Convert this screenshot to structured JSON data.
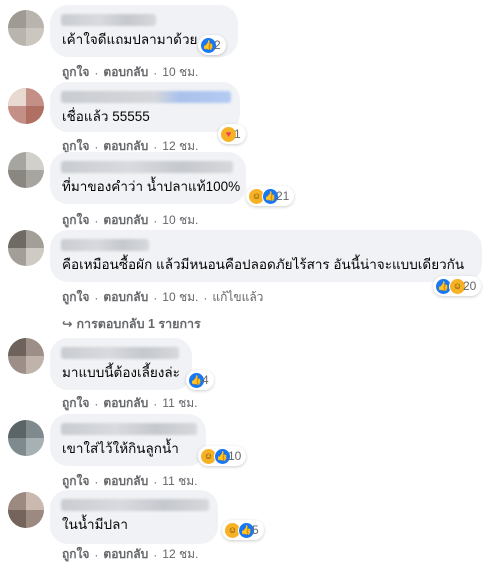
{
  "comments": [
    {
      "text": "เค้าใจดีแถมปลามาด้วย",
      "reactions": {
        "icons": [
          "like-icon"
        ],
        "count": "2"
      },
      "actions": {
        "like": "ถูกใจ",
        "reply": "ตอบกลับ",
        "time": "10 ชม."
      }
    },
    {
      "text": "เชื่อแล้ว 55555",
      "reactions": {
        "icons": [
          "care-icon"
        ],
        "count": "1"
      },
      "actions": {
        "like": "ถูกใจ",
        "reply": "ตอบกลับ",
        "time": "12 ชม."
      }
    },
    {
      "text": "ที่มาของคำว่า น้ำปลาแท้100%",
      "reactions": {
        "icons": [
          "haha-icon",
          "like-icon"
        ],
        "count": "21"
      },
      "actions": {
        "like": "ถูกใจ",
        "reply": "ตอบกลับ",
        "time": "10 ชม."
      }
    },
    {
      "text": "คือเหมือนซื้อผัก แล้วมีหนอนคือปลอดภัยไร้สาร อันนี้น่าจะแบบเดียวกัน",
      "reactions": {
        "icons": [
          "like-icon",
          "haha-icon"
        ],
        "count": "20"
      },
      "actions": {
        "like": "ถูกใจ",
        "reply": "ตอบกลับ",
        "time": "10 ชม.",
        "edited": "แก้ไขแล้ว"
      },
      "replies_label": "การตอบกลับ 1 รายการ"
    },
    {
      "text": "มาแบบนี้ต้องเลี้ยงล่ะ",
      "reactions": {
        "icons": [
          "like-icon"
        ],
        "count": "4"
      },
      "actions": {
        "like": "ถูกใจ",
        "reply": "ตอบกลับ",
        "time": "11 ชม."
      }
    },
    {
      "text": "เขาใส่ไว้ให้กินลูกน้ำ",
      "reactions": {
        "icons": [
          "haha-icon",
          "like-icon"
        ],
        "count": "10"
      },
      "actions": {
        "like": "ถูกใจ",
        "reply": "ตอบกลับ",
        "time": "11 ชม."
      }
    },
    {
      "text": "ในน้ำมีปลา",
      "reactions": {
        "icons": [
          "haha-icon",
          "like-icon"
        ],
        "count": "5"
      },
      "actions": {
        "like": "ถูกใจ",
        "reply": "ตอบกลับ",
        "time": "12 ชม."
      }
    }
  ],
  "colors": {
    "bubble": "#f0f2f5",
    "meta": "#65676b",
    "like": "#1877f2",
    "haha": "#f7b125"
  }
}
